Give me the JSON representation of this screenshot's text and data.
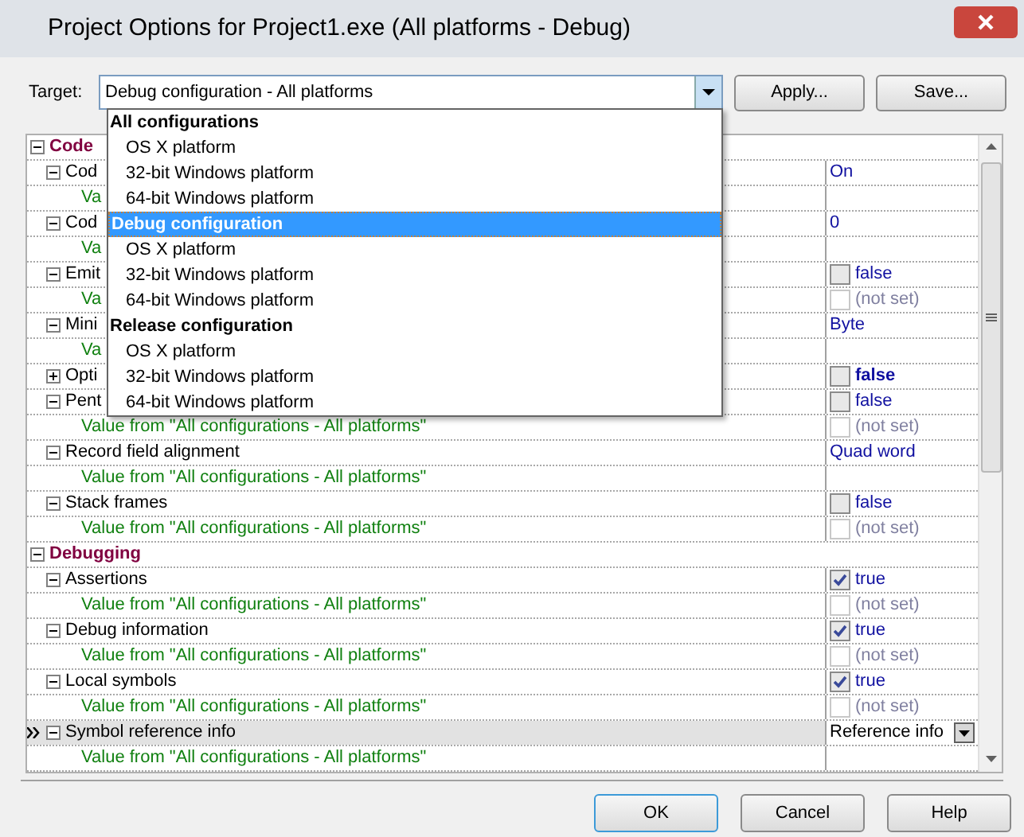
{
  "window": {
    "title": "Project Options for Project1.exe  (All platforms - Debug)"
  },
  "target": {
    "label": "Target:",
    "value": "Debug configuration - All platforms",
    "expanded": true
  },
  "header_buttons": [
    "Apply...",
    "Save..."
  ],
  "dropdown": {
    "options": [
      {
        "kind": "group",
        "label": "All configurations",
        "selected": false
      },
      {
        "kind": "item",
        "label": "OS X platform",
        "selected": false
      },
      {
        "kind": "item",
        "label": "32-bit Windows platform",
        "selected": false
      },
      {
        "kind": "item",
        "label": "64-bit Windows platform",
        "selected": false
      },
      {
        "kind": "group",
        "label": "Debug configuration",
        "selected": true
      },
      {
        "kind": "item",
        "label": "OS X platform",
        "selected": false
      },
      {
        "kind": "item",
        "label": "32-bit Windows platform",
        "selected": false
      },
      {
        "kind": "item",
        "label": "64-bit Windows platform",
        "selected": false
      },
      {
        "kind": "group",
        "label": "Release configuration",
        "selected": false
      },
      {
        "kind": "item",
        "label": "OS X platform",
        "selected": false
      },
      {
        "kind": "item",
        "label": "32-bit Windows platform",
        "selected": false
      },
      {
        "kind": "item",
        "label": "64-bit Windows platform",
        "selected": false
      }
    ]
  },
  "grid": {
    "rows": [
      {
        "kind": "category",
        "label": "Code",
        "expanded": true,
        "selected": false
      },
      {
        "kind": "option",
        "label": "Cod",
        "expanded": true,
        "selected": false,
        "value": {
          "kind": "text",
          "text": "On"
        }
      },
      {
        "kind": "value_from",
        "label": "Va",
        "selected": false
      },
      {
        "kind": "option",
        "label": "Cod",
        "expanded": true,
        "selected": false,
        "value": {
          "kind": "text",
          "text": "0"
        }
      },
      {
        "kind": "value_from",
        "label": "Va",
        "selected": false
      },
      {
        "kind": "option",
        "label": "Emit",
        "expanded": true,
        "selected": false,
        "value": {
          "kind": "checkbox",
          "text": "false",
          "checked": false,
          "disabled": false
        }
      },
      {
        "kind": "value_from",
        "label": "Va",
        "selected": false,
        "value": {
          "kind": "checkbox",
          "text": "(not set)",
          "checked": false,
          "disabled": true
        }
      },
      {
        "kind": "option",
        "label": "Mini",
        "expanded": true,
        "selected": false,
        "value": {
          "kind": "text",
          "text": "Byte"
        }
      },
      {
        "kind": "value_from",
        "label": "Va",
        "selected": false
      },
      {
        "kind": "option",
        "label": "Opti",
        "expanded": false,
        "selected": false,
        "value": {
          "kind": "checkbox",
          "text": "false",
          "checked": false,
          "disabled": false,
          "bold": true
        }
      },
      {
        "kind": "option",
        "label": "Pent",
        "expanded": true,
        "selected": false,
        "value": {
          "kind": "checkbox",
          "text": "false",
          "checked": false,
          "disabled": false
        }
      },
      {
        "kind": "value_from",
        "label": "Value from \"All configurations - All platforms\"",
        "selected": false,
        "value": {
          "kind": "checkbox",
          "text": "(not set)",
          "checked": false,
          "disabled": true
        }
      },
      {
        "kind": "option",
        "label": "Record field alignment",
        "expanded": true,
        "selected": false,
        "value": {
          "kind": "text",
          "text": "Quad word"
        }
      },
      {
        "kind": "value_from",
        "label": "Value from \"All configurations - All platforms\"",
        "selected": false
      },
      {
        "kind": "option",
        "label": "Stack frames",
        "expanded": true,
        "selected": false,
        "value": {
          "kind": "checkbox",
          "text": "false",
          "checked": false,
          "disabled": false
        }
      },
      {
        "kind": "value_from",
        "label": "Value from \"All configurations - All platforms\"",
        "selected": false,
        "value": {
          "kind": "checkbox",
          "text": "(not set)",
          "checked": false,
          "disabled": true
        }
      },
      {
        "kind": "category",
        "label": "Debugging",
        "expanded": true,
        "selected": false
      },
      {
        "kind": "option",
        "label": "Assertions",
        "expanded": true,
        "selected": false,
        "value": {
          "kind": "checkbox",
          "text": "true",
          "checked": true,
          "disabled": false
        }
      },
      {
        "kind": "value_from",
        "label": "Value from \"All configurations - All platforms\"",
        "selected": false,
        "value": {
          "kind": "checkbox",
          "text": "(not set)",
          "checked": false,
          "disabled": true
        }
      },
      {
        "kind": "option",
        "label": "Debug information",
        "expanded": true,
        "selected": false,
        "value": {
          "kind": "checkbox",
          "text": "true",
          "checked": true,
          "disabled": false
        }
      },
      {
        "kind": "value_from",
        "label": "Value from \"All configurations - All platforms\"",
        "selected": false,
        "value": {
          "kind": "checkbox",
          "text": "(not set)",
          "checked": false,
          "disabled": true
        }
      },
      {
        "kind": "option",
        "label": "Local symbols",
        "expanded": true,
        "selected": false,
        "value": {
          "kind": "checkbox",
          "text": "true",
          "checked": true,
          "disabled": false
        }
      },
      {
        "kind": "value_from",
        "label": "Value from \"All configurations - All platforms\"",
        "selected": false,
        "value": {
          "kind": "checkbox",
          "text": "(not set)",
          "checked": false,
          "disabled": true
        }
      },
      {
        "kind": "option",
        "label": "Symbol reference info",
        "expanded": true,
        "selected": true,
        "value": {
          "kind": "dropdown",
          "text": "Reference info"
        }
      },
      {
        "kind": "value_from",
        "label": "Value from \"All configurations - All platforms\"",
        "selected": false
      }
    ]
  },
  "footer_buttons": [
    {
      "label": "OK",
      "default": true
    },
    {
      "label": "Cancel",
      "default": false
    },
    {
      "label": "Help",
      "default": false
    }
  ]
}
